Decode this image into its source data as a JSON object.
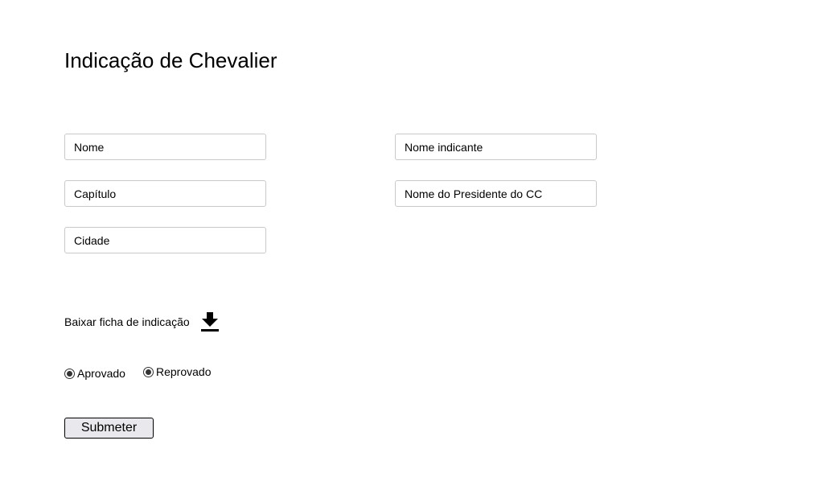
{
  "page": {
    "title": "Indicação de Chevalier"
  },
  "form": {
    "fields": {
      "nome": {
        "value": "",
        "placeholder": "Nome"
      },
      "capitulo": {
        "value": "",
        "placeholder": "Capítulo"
      },
      "cidade": {
        "value": "",
        "placeholder": "Cidade"
      },
      "nome_indicante": {
        "value": "",
        "placeholder": "Nome indicante"
      },
      "nome_presidente": {
        "value": "",
        "placeholder": "Nome do Presidente do CC"
      }
    },
    "download": {
      "label": "Baixar ficha de indicação",
      "icon": "download-icon"
    },
    "status": {
      "options": [
        {
          "label": "Aprovado",
          "selected": true
        },
        {
          "label": "Reprovado",
          "selected": true
        }
      ]
    },
    "submit_label": "Submeter"
  }
}
